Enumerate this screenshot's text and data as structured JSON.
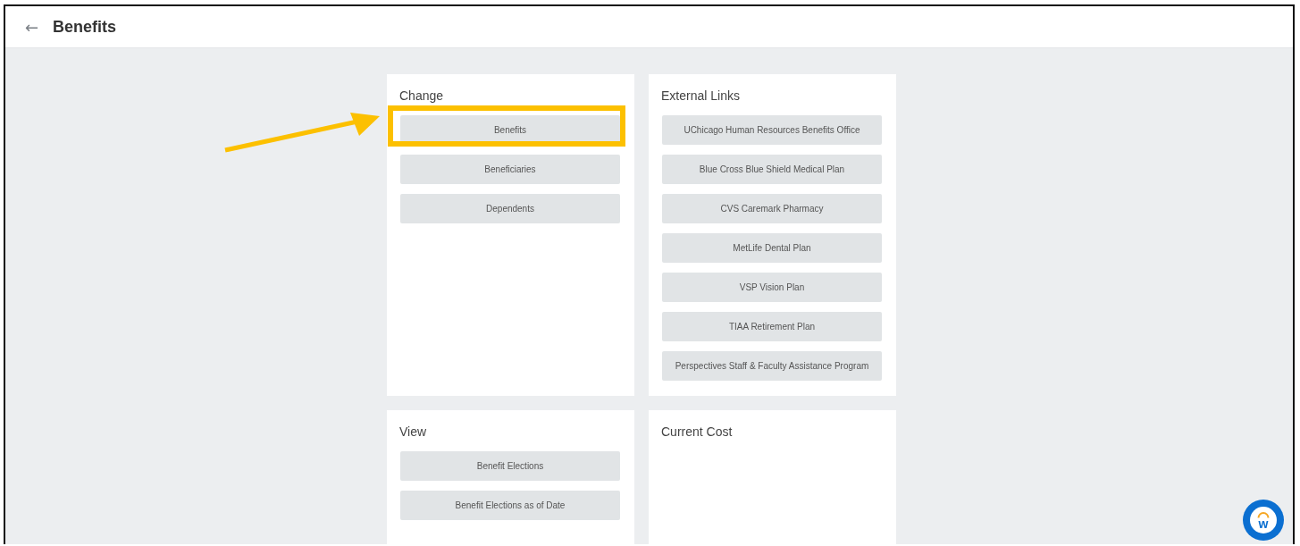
{
  "header": {
    "back_button": "←",
    "title": "Benefits"
  },
  "cards": [
    {
      "title": "Change",
      "items": [
        {
          "label": "Benefits",
          "highlighted": true
        },
        {
          "label": "Beneficiaries",
          "highlighted": false
        },
        {
          "label": "Dependents",
          "highlighted": false
        }
      ]
    },
    {
      "title": "External Links",
      "items": [
        {
          "label": "UChicago Human Resources Benefits Office",
          "highlighted": false
        },
        {
          "label": "Blue Cross Blue Shield Medical Plan",
          "highlighted": false
        },
        {
          "label": "CVS Caremark Pharmacy",
          "highlighted": false
        },
        {
          "label": "MetLife Dental Plan",
          "highlighted": false
        },
        {
          "label": "VSP Vision Plan",
          "highlighted": false
        },
        {
          "label": "TIAA Retirement Plan",
          "highlighted": false
        },
        {
          "label": "Perspectives Staff & Faculty Assistance Program",
          "highlighted": false
        }
      ]
    },
    {
      "title": "View",
      "items": [
        {
          "label": "Benefit Elections",
          "highlighted": false
        },
        {
          "label": "Benefit Elections as of Date",
          "highlighted": false
        }
      ]
    },
    {
      "title": "Current Cost"
    }
  ],
  "assistant_button": {
    "label": "w"
  }
}
